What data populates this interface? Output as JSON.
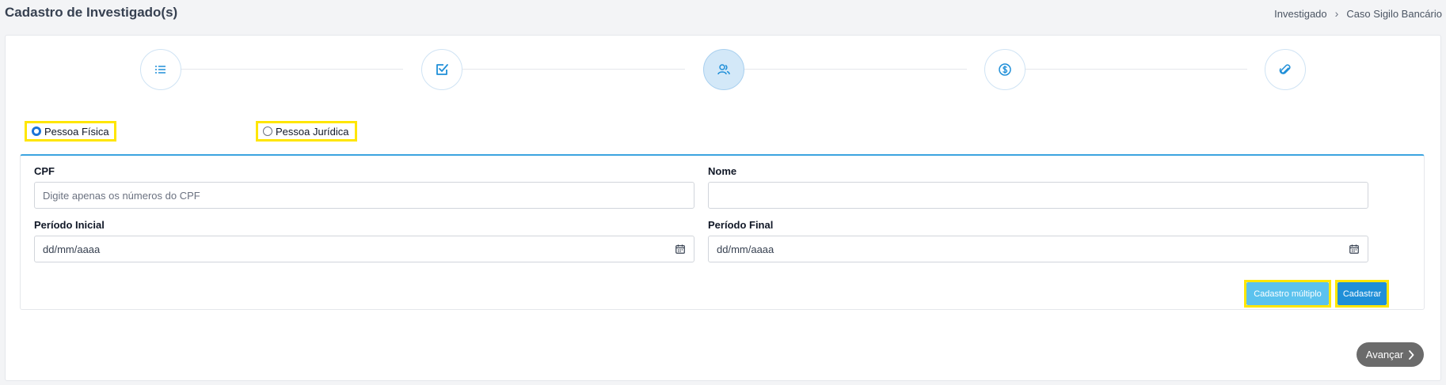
{
  "header": {
    "title": "Cadastro de Investigado(s)",
    "breadcrumb": [
      "Investigado",
      "›",
      "Caso Sigilo Bancário"
    ]
  },
  "stepper": {
    "steps": [
      {
        "icon": "list-icon",
        "active": false
      },
      {
        "icon": "checkbox-icon",
        "active": false
      },
      {
        "icon": "users-icon",
        "active": true
      },
      {
        "icon": "dollar-icon",
        "active": false
      },
      {
        "icon": "paperclip-icon",
        "active": false
      }
    ]
  },
  "person_type": {
    "option_fisica": "Pessoa Física",
    "option_juridica": "Pessoa Jurídica",
    "selected": "Pessoa Física"
  },
  "form": {
    "cpf_label": "CPF",
    "cpf_placeholder": "Digite apenas os números do CPF",
    "cpf_value": "",
    "nome_label": "Nome",
    "nome_value": "",
    "periodo_inicial_label": "Período Inicial",
    "periodo_inicial_value": "dd/mm/aaaa",
    "periodo_final_label": "Período Final",
    "periodo_final_value": "dd/mm/aaaa"
  },
  "actions": {
    "cadastro_multiplo": "Cadastro múltiplo",
    "cadastrar": "Cadastrar",
    "avancar": "Avançar"
  },
  "colors": {
    "accent": "#1f8fd8",
    "light_accent": "#5bc2ee",
    "highlight": "#ffe600"
  }
}
